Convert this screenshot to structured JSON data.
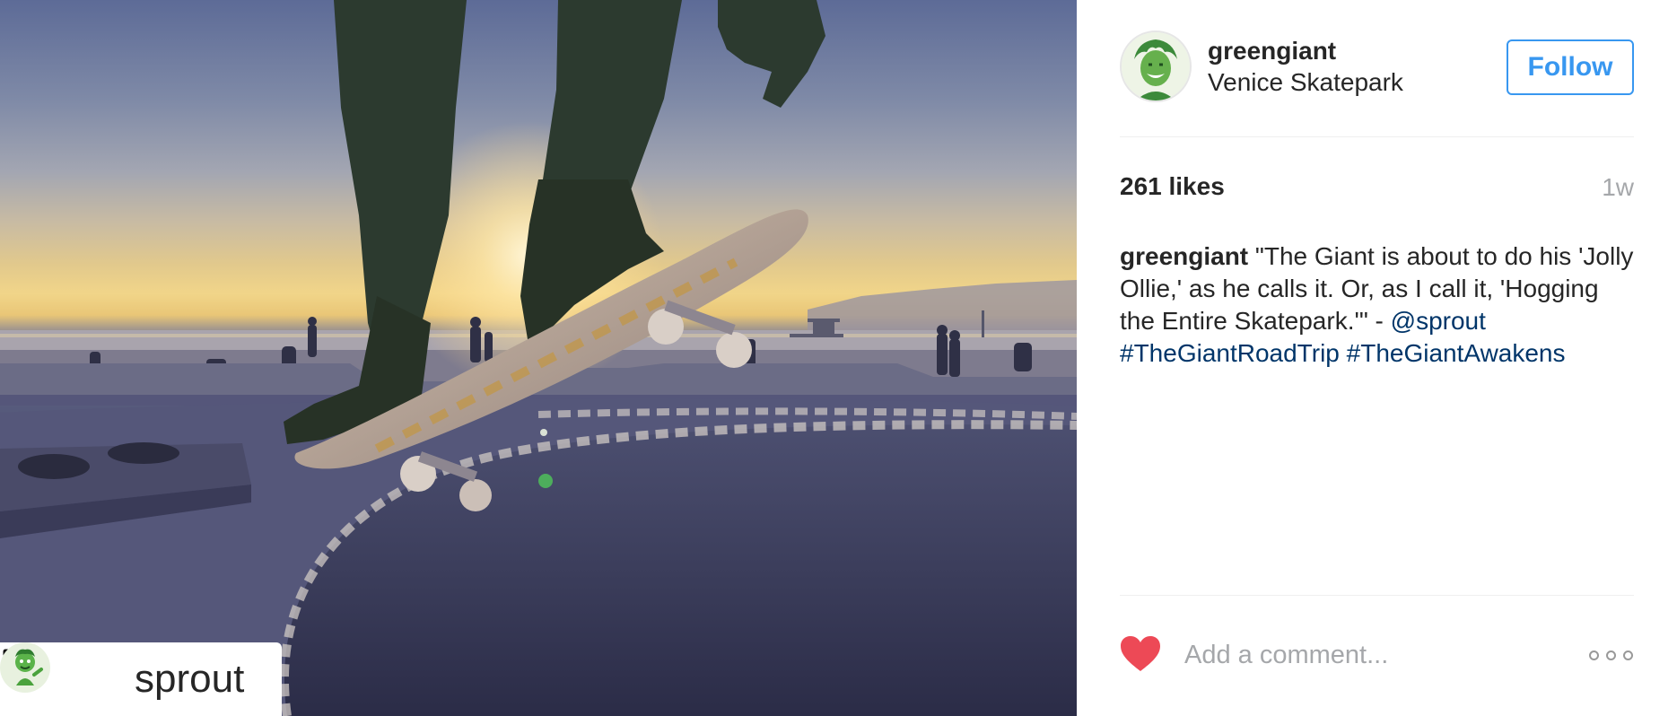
{
  "post": {
    "photo": {
      "description_icon": "skateboard-photo",
      "repost": {
        "icon": "repost-icon",
        "username": "sprout"
      }
    },
    "header": {
      "username": "greengiant",
      "location": "Venice Skatepark",
      "follow_label": "Follow"
    },
    "stats": {
      "likes": "261 likes",
      "time": "1w"
    },
    "caption": {
      "username": "greengiant",
      "text": " \"The Giant is about to do his 'Jolly Ollie,' as he calls it. Or, as I call it, 'Hogging the Entire Skatepark.'\" - ",
      "mention": "@sprout",
      "hashtag_1": "#TheGiantRoadTrip",
      "hashtag_2": "#TheGiantAwakens"
    },
    "comment_bar": {
      "placeholder": "Add a comment...",
      "like_icon": "heart-icon",
      "more_icon": "more-options-icon"
    },
    "colors": {
      "follow_blue": "#3897f0",
      "link_blue": "#003569",
      "heart_red": "#ed4956",
      "muted_gray": "#a5a7aa"
    }
  }
}
